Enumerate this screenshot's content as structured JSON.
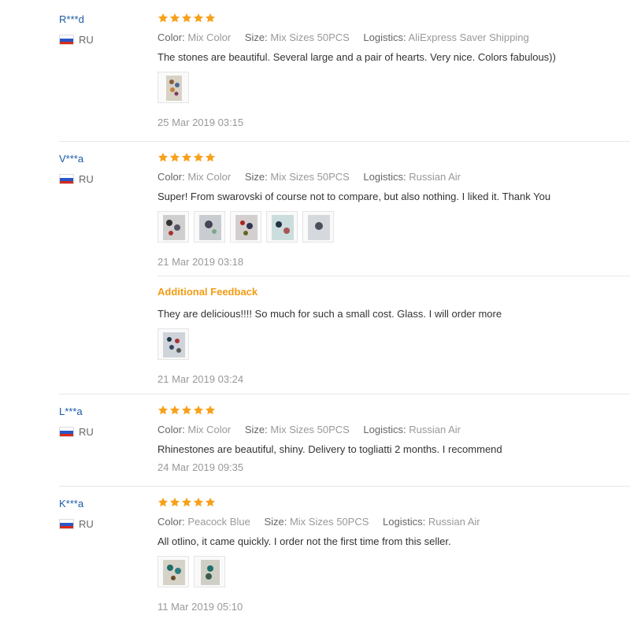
{
  "colors": {
    "star": "#f7a11a",
    "username": "#1a5aa6",
    "additional_feedback": "#f39c12"
  },
  "labels": {
    "color": "Color:",
    "size": "Size:",
    "logistics": "Logistics:",
    "additional_feedback": "Additional Feedback"
  },
  "reviews": [
    {
      "user": "R***d",
      "country": "RU",
      "rating": 5,
      "color": "Mix Color",
      "size": "Mix Sizes 50PCS",
      "logistics": "AliExpress Saver Shipping",
      "text": "The stones are beautiful. Several large and a pair of hearts. Very nice. Colors fabulous))",
      "photos": 1,
      "date": "25 Mar 2019 03:15"
    },
    {
      "user": "V***a",
      "country": "RU",
      "rating": 5,
      "color": "Mix Color",
      "size": "Mix Sizes 50PCS",
      "logistics": "Russian Air",
      "text": "Super! From swarovski of course not to compare, but also nothing. I liked it. Thank You",
      "photos": 5,
      "date": "21 Mar 2019 03:18",
      "additional": {
        "text": "They are delicious!!!! So much for such a small cost. Glass. I will order more",
        "photos": 1,
        "date": "21 Mar 2019 03:24"
      }
    },
    {
      "user": "L***a",
      "country": "RU",
      "rating": 5,
      "color": "Mix Color",
      "size": "Mix Sizes 50PCS",
      "logistics": "Russian Air",
      "text": "Rhinestones are beautiful, shiny. Delivery to togliatti 2 months. I recommend",
      "photos": 0,
      "date": "24 Mar 2019 09:35"
    },
    {
      "user": "K***a",
      "country": "RU",
      "rating": 5,
      "color": "Peacock Blue",
      "size": "Mix Sizes 50PCS",
      "logistics": "Russian Air",
      "text": "All otlino, it came quickly. I order not the first time from this seller.",
      "photos": 2,
      "date": "11 Mar 2019 05:10"
    }
  ]
}
